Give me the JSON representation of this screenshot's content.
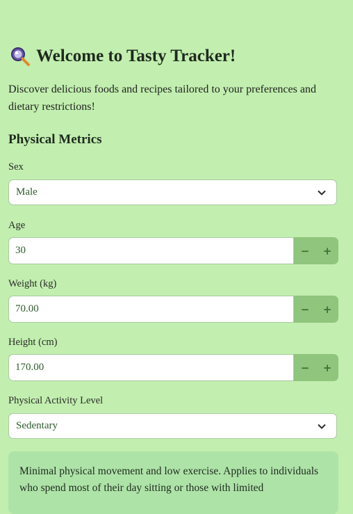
{
  "header": {
    "icon": "magnifying-glass-icon",
    "title": "Welcome to Tasty Tracker!"
  },
  "intro": "Discover delicious foods and recipes tailored to your preferences and dietary restrictions!",
  "section": {
    "title": "Physical Metrics"
  },
  "fields": {
    "sex": {
      "label": "Sex",
      "value": "Male"
    },
    "age": {
      "label": "Age",
      "value": "30"
    },
    "weight": {
      "label": "Weight (kg)",
      "value": "70.00"
    },
    "height": {
      "label": "Height (cm)",
      "value": "170.00"
    },
    "activity": {
      "label": "Physical Activity Level",
      "value": "Sedentary"
    }
  },
  "stepper": {
    "minus": "−",
    "plus": "+"
  },
  "info": {
    "text": "Minimal physical movement and low exercise. Applies to individuals who spend most of their day sitting or those with limited"
  },
  "colors": {
    "background": "#c2efaf",
    "stepper_button": "#8fc57d",
    "info_box": "#aee3a8",
    "value_text": "#2e5a2e"
  }
}
